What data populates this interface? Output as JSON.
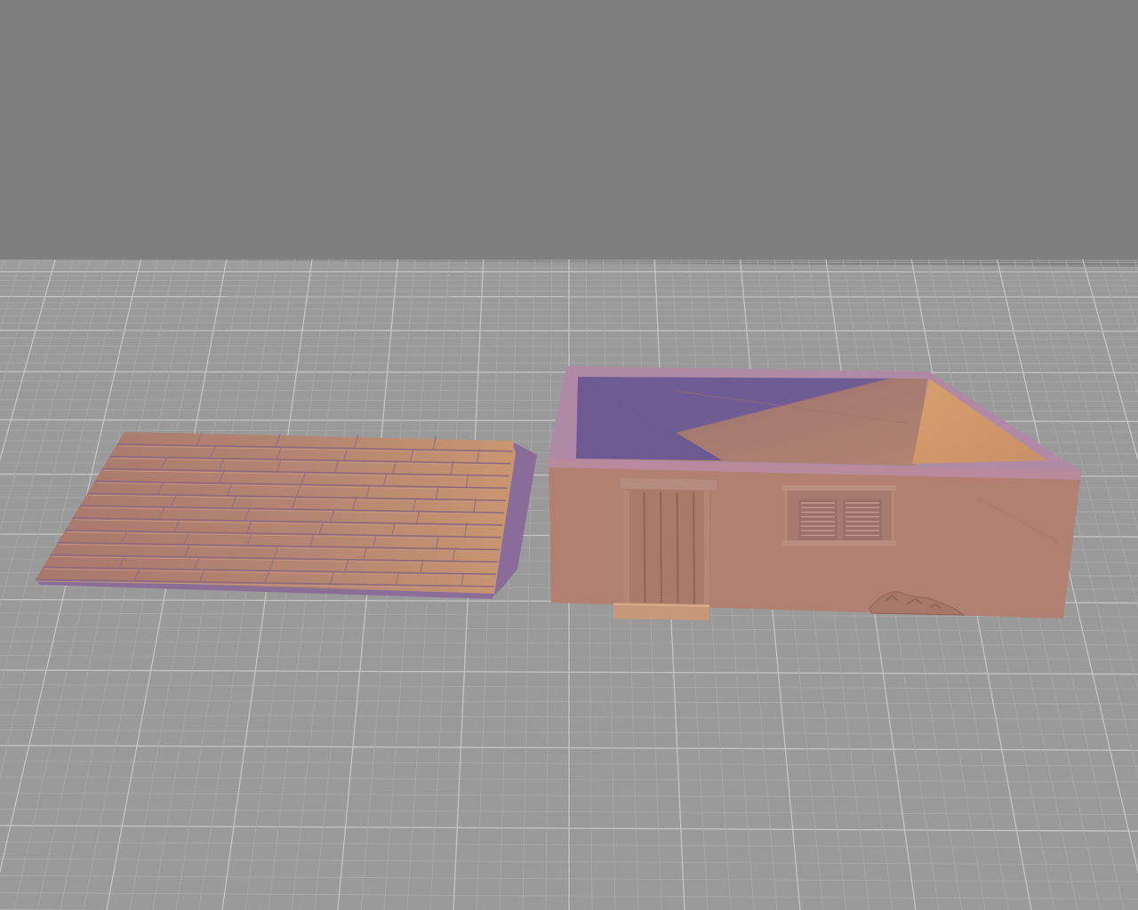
{
  "viewport": {
    "background_color": "#7f7f7f",
    "floor_color": "#9a9a9a",
    "grid_minor_color": "#a9a9a9",
    "grid_major_color": "#c4c4c4"
  },
  "scene": {
    "objects": [
      {
        "name": "roof-tile-panel",
        "type": "shingled roof slab",
        "color": "#b58672",
        "shadow_color": "#8a6c9a"
      },
      {
        "name": "building-base",
        "type": "open-top house box",
        "wall_color": "#b18070",
        "rim_color": "#b08aa4",
        "interior_wall_color": "#d19a6c",
        "shadow_color": "#7f6699"
      },
      {
        "name": "door",
        "type": "wooden plank door",
        "color": "#a97a6a"
      },
      {
        "name": "window-shutters",
        "type": "double louvered shutters",
        "color": "#a67a6e"
      },
      {
        "name": "rubble-detail",
        "type": "ground debris",
        "color": "#a77868"
      }
    ]
  }
}
